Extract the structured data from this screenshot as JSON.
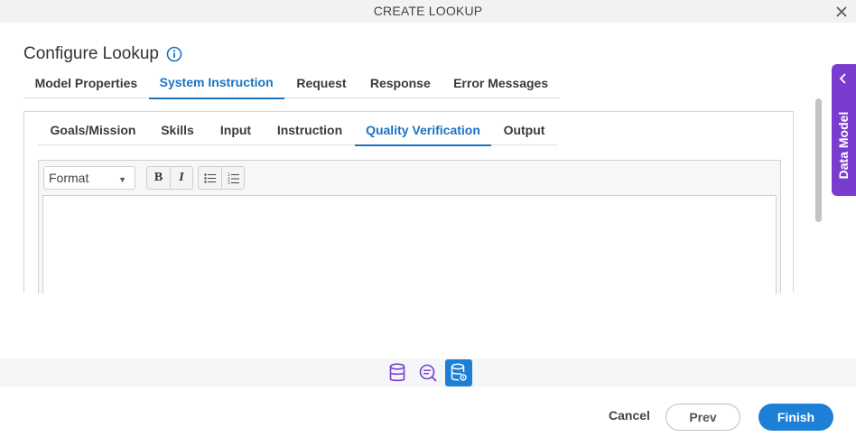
{
  "window": {
    "title": "CREATE LOOKUP"
  },
  "heading": {
    "title": "Configure Lookup"
  },
  "tabs": [
    {
      "label": "Model Properties",
      "active": false
    },
    {
      "label": "System Instruction",
      "active": true
    },
    {
      "label": "Request",
      "active": false
    },
    {
      "label": "Response",
      "active": false
    },
    {
      "label": "Error Messages",
      "active": false
    }
  ],
  "subtabs": [
    {
      "label": "Goals/Mission",
      "active": false
    },
    {
      "label": "Skills",
      "active": false
    },
    {
      "label": "Input",
      "active": false
    },
    {
      "label": "Instruction",
      "active": false
    },
    {
      "label": "Quality Verification",
      "active": true
    },
    {
      "label": "Output",
      "active": false
    }
  ],
  "editor": {
    "format_value": "Format",
    "bold_label": "B",
    "italic_label": "I",
    "content": ""
  },
  "side_panel": {
    "label": "Data Model"
  },
  "bottom_icons": [
    "database-icon",
    "search-comment-icon",
    "database-settings-icon"
  ],
  "footer": {
    "cancel_label": "Cancel",
    "prev_label": "Prev",
    "finish_label": "Finish"
  },
  "colors": {
    "accent": "#1e7fd6",
    "tab_active": "#1a73c4",
    "side_panel": "#7a3ccf"
  }
}
